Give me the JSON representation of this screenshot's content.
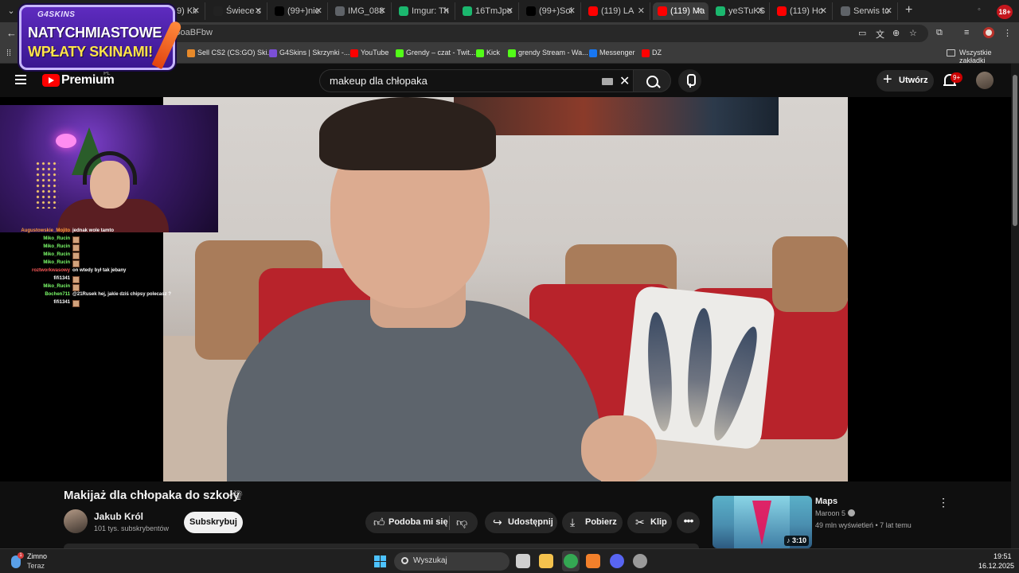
{
  "browser": {
    "tabs": [
      {
        "label": "9) Kir",
        "color": "#ff0000",
        "active": false
      },
      {
        "label": "Świece s",
        "color": "#222222",
        "active": false
      },
      {
        "label": "(99+)nie",
        "color": "#000000",
        "active": false
      },
      {
        "label": "IMG_088",
        "color": "#5f6368",
        "active": false
      },
      {
        "label": "Imgur: Th",
        "color": "#1bb76e",
        "active": false
      },
      {
        "label": "16TmJpo",
        "color": "#1bb76e",
        "active": false
      },
      {
        "label": "(99+)Sol",
        "color": "#000000",
        "active": false
      },
      {
        "label": "(119) LA",
        "color": "#ff0000",
        "active": false
      },
      {
        "label": "(119) Ma",
        "color": "#ff0000",
        "active": true
      },
      {
        "label": "yeSTuKS",
        "color": "#1bb76e",
        "active": false
      },
      {
        "label": "(119) Ho",
        "color": "#ff0000",
        "active": false
      },
      {
        "label": "Serwis to",
        "color": "#5f6368",
        "active": false
      }
    ],
    "profile_badge": "18+",
    "address_fragment": "GoaBFbw",
    "bookmarks": [
      {
        "label": "Sell CS2 (CS:GO) Ski...",
        "color": "#e88a2a"
      },
      {
        "label": "G4Skins | Skrzynki -...",
        "color": "#7b4fd6"
      },
      {
        "label": "YouTube",
        "color": "#ff0000"
      },
      {
        "label": "Grendy – czat - Twit...",
        "color": "#53fc18"
      },
      {
        "label": "Kick",
        "color": "#53fc18"
      },
      {
        "label": "grendy Stream - Wa...",
        "color": "#53fc18"
      },
      {
        "label": "Messenger",
        "color": "#1877f2"
      },
      {
        "label": "DZ",
        "color": "#ff0000"
      }
    ],
    "all_bookmarks_label": "Wszystkie zakładki"
  },
  "promo": {
    "logo": "G4SKINS",
    "line1": "NATYCHMIASTOWE",
    "line2": "WPŁATY SKINAMI!"
  },
  "youtube": {
    "brand": "Premium",
    "region": "PL",
    "search_value": "makeup dla chłopaka",
    "create_label": "Utwórz",
    "notification_count": "9+"
  },
  "chat": [
    {
      "user": "Augustowskie_Mojito",
      "color": "#ff9a3c",
      "message": "jednak wole tamto",
      "emote": false
    },
    {
      "user": "Miko_Rucin",
      "color": "#7dff6b",
      "message": "",
      "emote": true
    },
    {
      "user": "Miko_Rucin",
      "color": "#7dff6b",
      "message": "",
      "emote": true
    },
    {
      "user": "Miko_Rucin",
      "color": "#7dff6b",
      "message": "",
      "emote": true
    },
    {
      "user": "Miko_Rucin",
      "color": "#7dff6b",
      "message": "",
      "emote": true
    },
    {
      "user": "roztworkwasowy",
      "color": "#ff5a5a",
      "message": "on wtedy był tak jebany",
      "emote": false
    },
    {
      "user": "fifi1341",
      "color": "#ffffff",
      "message": "",
      "emote": true
    },
    {
      "user": "Miko_Rucin",
      "color": "#7dff6b",
      "message": "",
      "emote": true
    },
    {
      "user": "Bochen711",
      "color": "#7dff6b",
      "message": "@21Rusek hej, jakie dziś chipsy polecasz ?",
      "emote": false
    },
    {
      "user": "fifi1341",
      "color": "#ffffff",
      "message": "",
      "emote": true
    }
  ],
  "video": {
    "title": "Makijaż dla chłopaka do szkoły",
    "title_emoji": "🌪",
    "channel": "Jakub Król",
    "subscribers": "101 tys. subskrybentów",
    "subscribe_label": "Subskrybuj",
    "actions": {
      "like": "Podoba mi się",
      "share": "Udostępnij",
      "download": "Pobierz",
      "clip": "Klip",
      "more": "•••"
    }
  },
  "recommendation": {
    "title": "Maps",
    "channel": "Maroon 5",
    "meta": "49 mln wyświetleń • 7 lat temu",
    "duration": "3:10"
  },
  "taskbar": {
    "weather_title": "Zimno",
    "weather_sub": "Teraz",
    "weather_badge": "1",
    "search_placeholder": "Wyszukaj",
    "time": "19:51",
    "date": "16.12.2025",
    "apps": [
      {
        "name": "task-view-icon",
        "color": "#cfcfcf"
      },
      {
        "name": "file-explorer-icon",
        "color": "#f4c24d"
      },
      {
        "name": "chrome-icon",
        "color": "#34a853"
      },
      {
        "name": "app-orange-icon",
        "color": "#f2802b"
      },
      {
        "name": "discord-icon",
        "color": "#5865f2"
      },
      {
        "name": "settings-icon",
        "color": "#9a9a9a"
      }
    ]
  }
}
